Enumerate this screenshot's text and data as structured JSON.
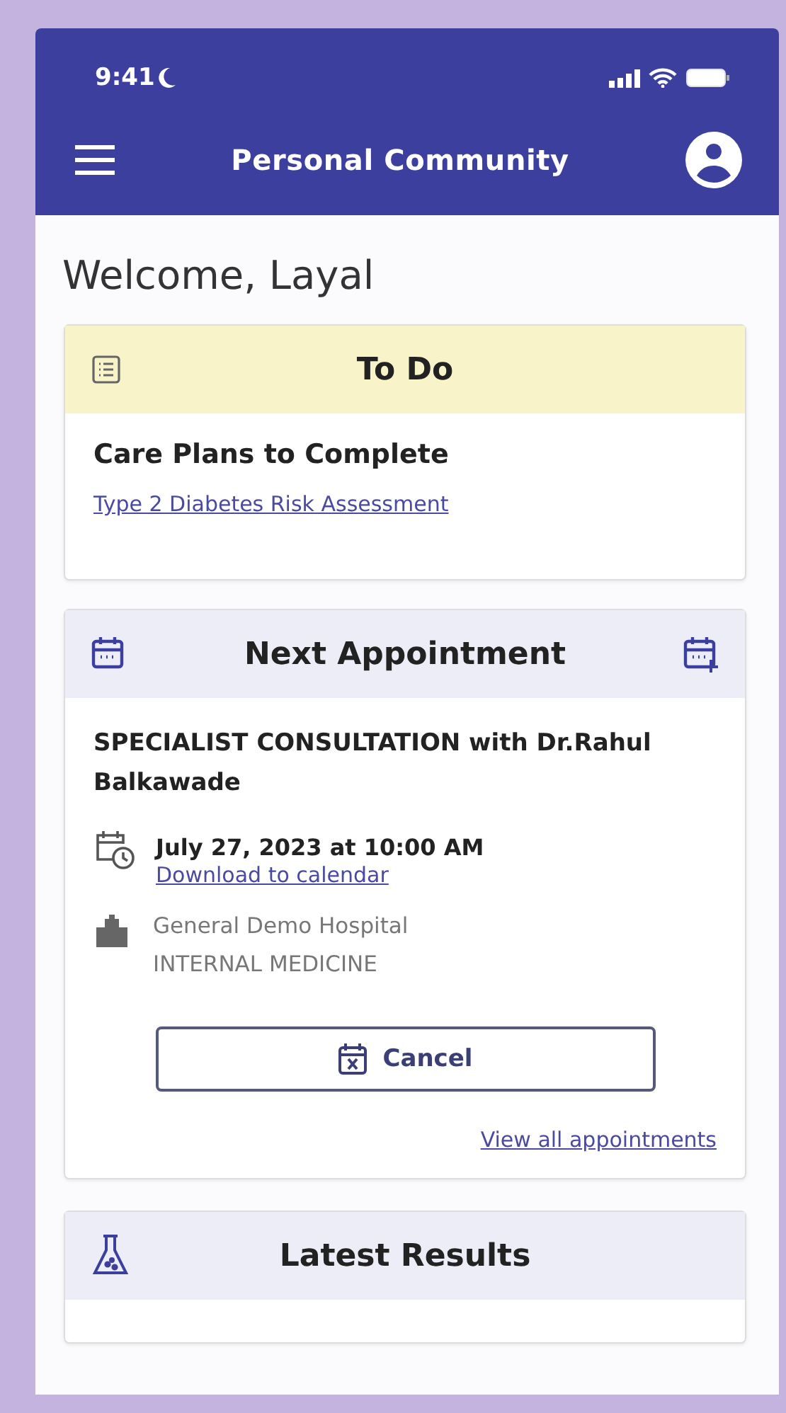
{
  "status_bar": {
    "time": "9:41"
  },
  "header": {
    "title": "Personal Community"
  },
  "welcome": "Welcome, Layal",
  "todo": {
    "title": "To Do",
    "section": "Care Plans to Complete",
    "links": [
      "Type 2 Diabetes Risk Assessment"
    ]
  },
  "appointment": {
    "title": "Next Appointment",
    "name": "SPECIALIST CONSULTATION with Dr.Rahul Balkawade",
    "datetime": "July 27, 2023 at 10:00 AM",
    "download_link": "Download to calendar",
    "hospital": "General Demo Hospital",
    "department": "INTERNAL MEDICINE",
    "cancel_button": "Cancel",
    "view_all_link": "View all appointments"
  },
  "results": {
    "title": "Latest Results"
  }
}
